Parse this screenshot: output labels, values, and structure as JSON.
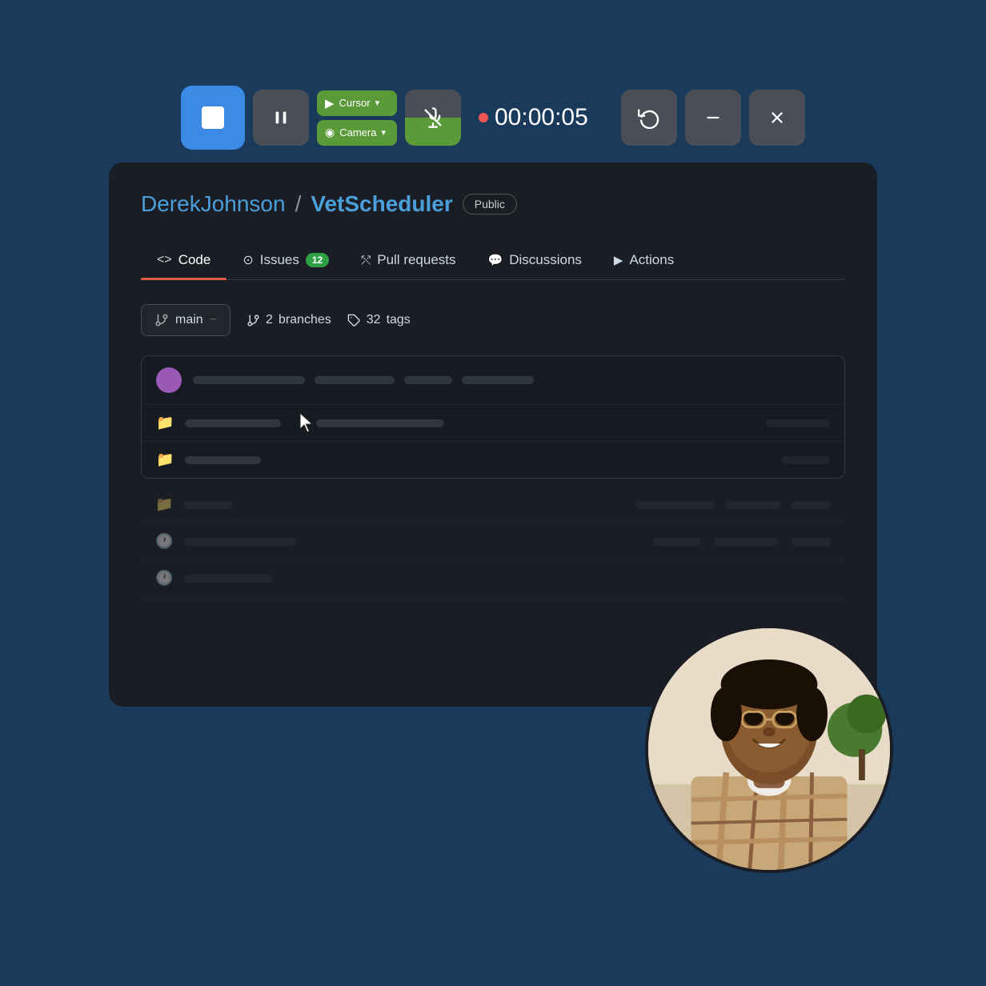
{
  "toolbar": {
    "stop_label": "Stop",
    "pause_label": "Pause",
    "cursor_btn_label": "Cursor",
    "camera_btn_label": "Camera",
    "mic_btn_label": "Mic",
    "slash_label": "Slash",
    "timer": "00:00:05",
    "reset_label": "Reset",
    "minimize_label": "Minimize",
    "close_label": "Close"
  },
  "repo": {
    "owner": "DerekJohnson",
    "name": "VetScheduler",
    "visibility": "Public"
  },
  "tabs": [
    {
      "id": "code",
      "label": "Code",
      "active": true
    },
    {
      "id": "issues",
      "label": "Issues",
      "badge": "12"
    },
    {
      "id": "pull-requests",
      "label": "Pull requests"
    },
    {
      "id": "discussions",
      "label": "Discussions"
    },
    {
      "id": "actions",
      "label": "Actions"
    }
  ],
  "branch": {
    "current": "main",
    "branches_count": "2",
    "branches_label": "branches",
    "tags_count": "32",
    "tags_label": "tags"
  },
  "file_rows": [
    {
      "type": "folder",
      "name_width": 120,
      "date_width": 80
    },
    {
      "type": "folder",
      "name_width": 95,
      "date_width": 0
    }
  ]
}
